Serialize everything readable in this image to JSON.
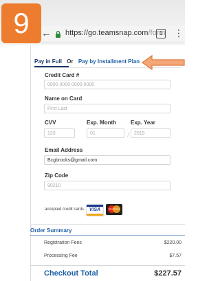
{
  "step": {
    "number": "9"
  },
  "browser": {
    "url_main": "https://go.teamsnap.com",
    "url_dim": "/form",
    "tab_count": "1"
  },
  "payment_tabs": {
    "pay_in_full": "Pay in Full",
    "or": "Or",
    "installment": "Pay by Installment Plan"
  },
  "form": {
    "card_number": {
      "label": "Credit Card #",
      "placeholder": "0000 0000 0000 0000"
    },
    "name_on_card": {
      "label": "Name on Card",
      "placeholder": "First Last"
    },
    "cvv": {
      "label": "CVV",
      "placeholder": "123"
    },
    "exp_month": {
      "label": "Exp. Month",
      "placeholder": "01"
    },
    "exp_year": {
      "label": "Exp. Year",
      "placeholder": "2019"
    },
    "exp_separator": "/",
    "email": {
      "label": "Email Address",
      "value": "Bcgbrooks@gmail.com"
    },
    "zip": {
      "label": "Zip Code",
      "placeholder": "90210"
    },
    "accepted_cards_label": "accepted credit cards",
    "card_brands": [
      "VISA",
      "MasterCard"
    ]
  },
  "order_summary": {
    "title": "Order Summary",
    "rows": [
      {
        "label": "Registration Fees",
        "value": "$220.00"
      },
      {
        "label": "Processing Fee",
        "value": "$7.57"
      }
    ],
    "checkout_label": "Checkout Total",
    "checkout_value": "$227.57"
  },
  "colors": {
    "badge": "#ee7c2e",
    "link_blue": "#1f5fa8",
    "secure_green": "#2e8b3d"
  }
}
